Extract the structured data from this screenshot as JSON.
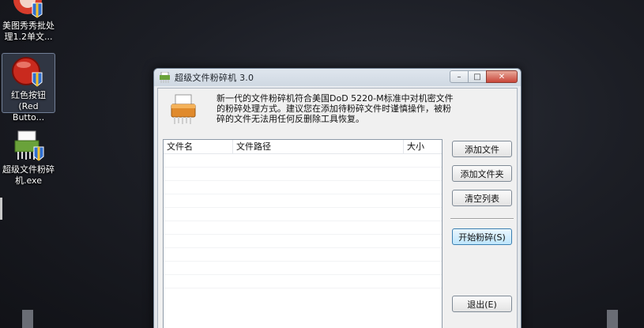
{
  "desktop": {
    "icons": [
      {
        "label": "美图秀秀批处\n理1.2单文..."
      },
      {
        "label": "红色按钮\n(Red Butto..."
      },
      {
        "label": "超级文件粉碎\n机.exe"
      }
    ]
  },
  "window": {
    "title": "超级文件粉碎机  3.0",
    "controls": {
      "minimize": "–",
      "maximize": "□",
      "close": "✕"
    },
    "description": "新一代的文件粉碎机符合美国DoD 5220-M标准中对机密文件的粉碎处理方式。建议您在添加待粉碎文件时谨慎操作，被粉碎的文件无法用任何反删除工具恢复。",
    "list": {
      "columns": {
        "name": "文件名",
        "path": "文件路径",
        "size": "大小"
      }
    },
    "buttons": {
      "add_file": "添加文件",
      "add_folder": "添加文件夹",
      "clear_list": "清空列表",
      "start": "开始粉碎(S)",
      "exit": "退出(E)"
    }
  }
}
